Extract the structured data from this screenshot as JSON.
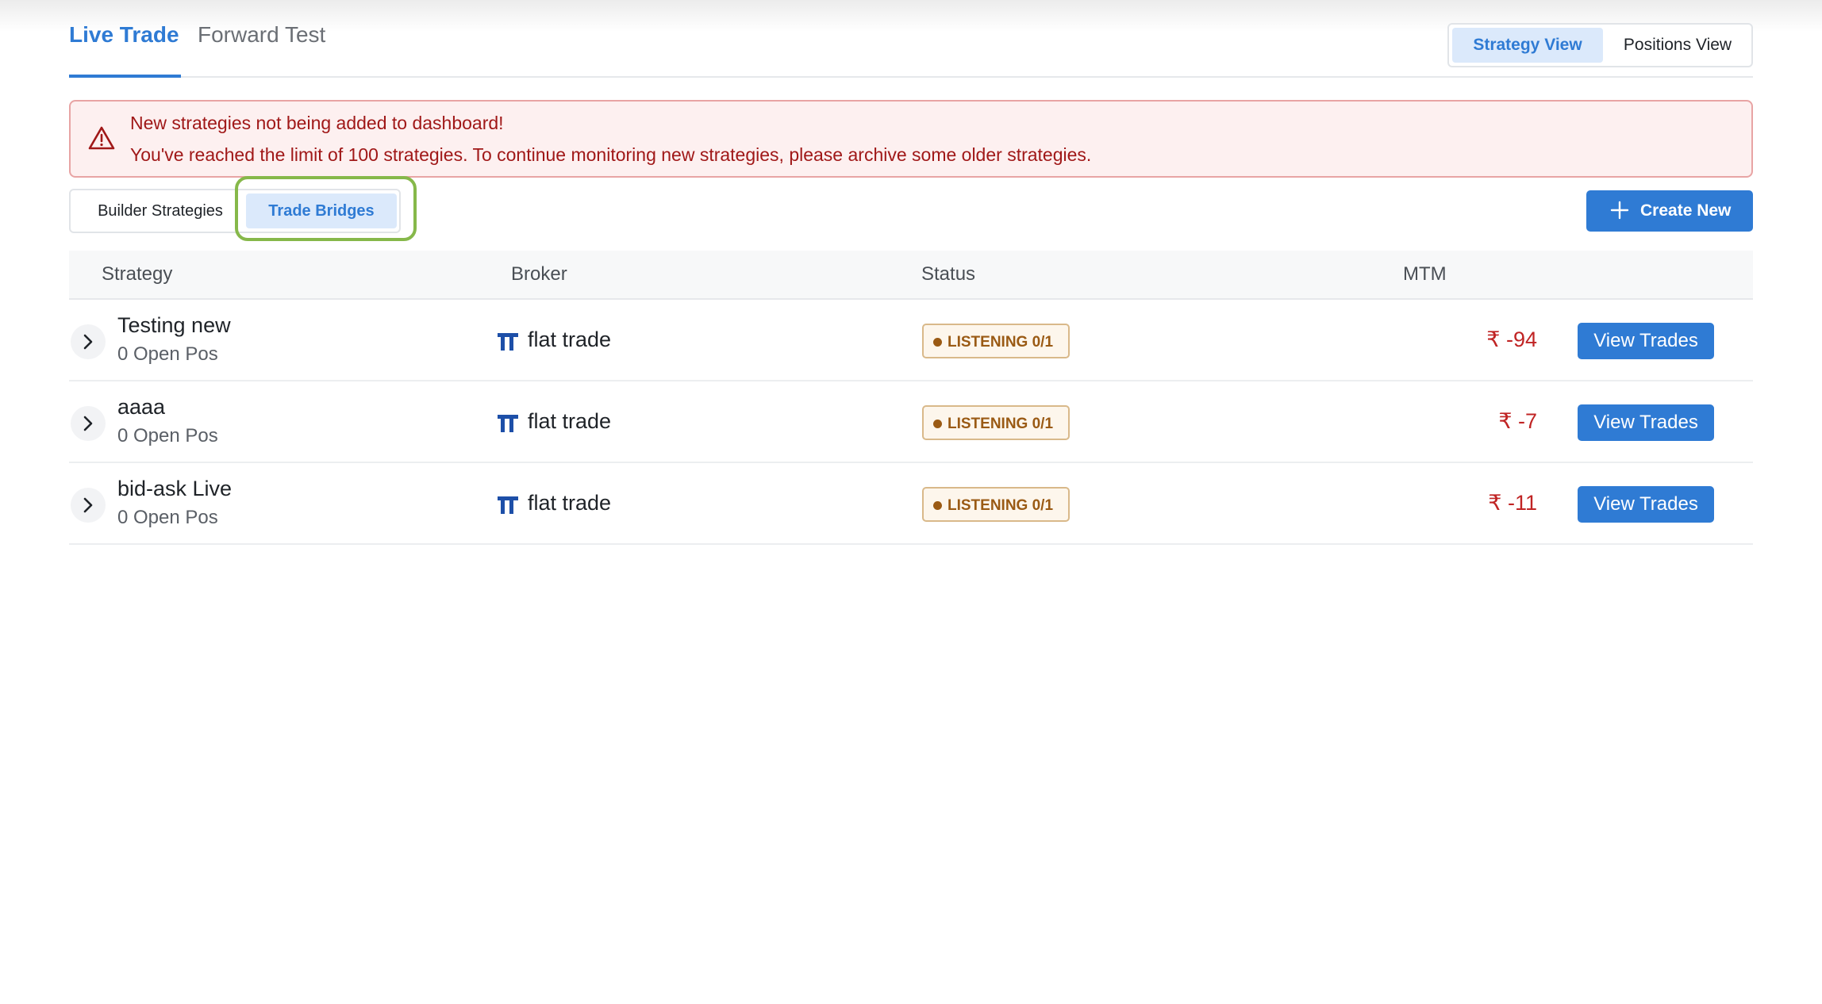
{
  "header": {
    "tabs": [
      {
        "label": "Live Trade",
        "active": true
      },
      {
        "label": "Forward Test",
        "active": false
      }
    ],
    "view_toggle": [
      {
        "label": "Strategy View",
        "active": true
      },
      {
        "label": "Positions View",
        "active": false
      }
    ]
  },
  "alert": {
    "title": "New strategies not being added to dashboard!",
    "message": "You've reached the limit of 100 strategies. To continue monitoring new strategies, please archive some older strategies.",
    "icon": "warning-triangle-icon",
    "color": "#a01818"
  },
  "subtabs": [
    {
      "label": "Builder Strategies",
      "active": false
    },
    {
      "label": "Trade Bridges",
      "active": true
    }
  ],
  "create_button": {
    "label": "Create New",
    "icon": "plus-icon"
  },
  "table": {
    "columns": [
      "Strategy",
      "Broker",
      "Status",
      "MTM"
    ],
    "rows": [
      {
        "name": "Testing new",
        "positions": "0 Open Pos",
        "broker": "flat trade",
        "status": "LISTENING 0/1",
        "mtm": "₹ -94",
        "action": "View Trades"
      },
      {
        "name": "aaaa",
        "positions": "0 Open Pos",
        "broker": "flat trade",
        "status": "LISTENING 0/1",
        "mtm": "₹ -7",
        "action": "View Trades"
      },
      {
        "name": "bid-ask Live",
        "positions": "0 Open Pos",
        "broker": "flat trade",
        "status": "LISTENING 0/1",
        "mtm": "₹ -11",
        "action": "View Trades"
      }
    ]
  },
  "colors": {
    "accent": "#2f7bd4",
    "negative": "#c02424",
    "status": "#9a5a14",
    "highlight": "#86b84a"
  }
}
